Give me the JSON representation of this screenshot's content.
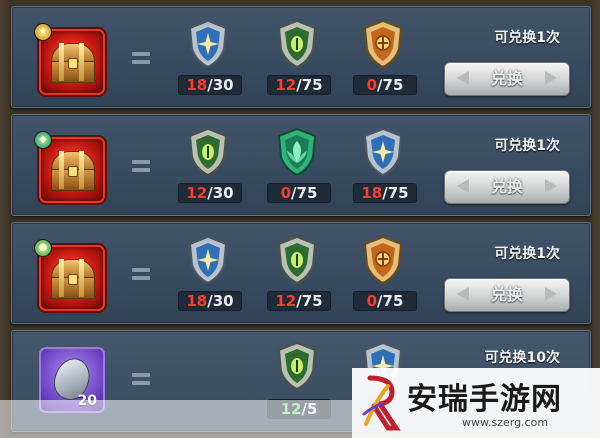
{
  "rows": [
    {
      "badge_gem": "gold-star",
      "reward_icon": "treasure-chest-icon",
      "status": "可兑换1次",
      "button": "兑换",
      "costs": [
        {
          "icon": "blue-star-shield-icon",
          "have": "18",
          "sep": "/",
          "need": "30"
        },
        {
          "icon": "green-eye-shield-icon",
          "have": "12",
          "sep": "/",
          "need": "75"
        },
        {
          "icon": "gold-crest-shield-icon",
          "have": "0",
          "sep": "/",
          "need": "75"
        }
      ]
    },
    {
      "badge_gem": "green-gem",
      "reward_icon": "treasure-chest-icon",
      "status": "可兑换1次",
      "button": "兑换",
      "costs": [
        {
          "icon": "green-eye-shield-icon",
          "have": "12",
          "sep": "/",
          "need": "30"
        },
        {
          "icon": "emerald-leaf-shield-icon",
          "have": "0",
          "sep": "/",
          "need": "75"
        },
        {
          "icon": "blue-star-shield-icon",
          "have": "18",
          "sep": "/",
          "need": "75"
        }
      ]
    },
    {
      "badge_gem": "green-dot",
      "reward_icon": "treasure-chest-icon",
      "status": "可兑换1次",
      "button": "兑换",
      "costs": [
        {
          "icon": "blue-star-shield-icon",
          "have": "18",
          "sep": "/",
          "need": "30"
        },
        {
          "icon": "green-eye-shield-icon",
          "have": "12",
          "sep": "/",
          "need": "75"
        },
        {
          "icon": "gold-crest-shield-icon",
          "have": "0",
          "sep": "/",
          "need": "75"
        }
      ]
    },
    {
      "reward_icon": "silver-crystal-icon",
      "reward_qty": "20",
      "status": "可兑换10次",
      "costs": [
        {
          "icon": "green-eye-shield-icon",
          "have": "12",
          "sep": "/",
          "need": "5"
        },
        {
          "icon": "blue-star-shield-icon"
        }
      ]
    }
  ],
  "watermark": {
    "title": "安瑞手游网",
    "url": "www.szerg.com"
  }
}
